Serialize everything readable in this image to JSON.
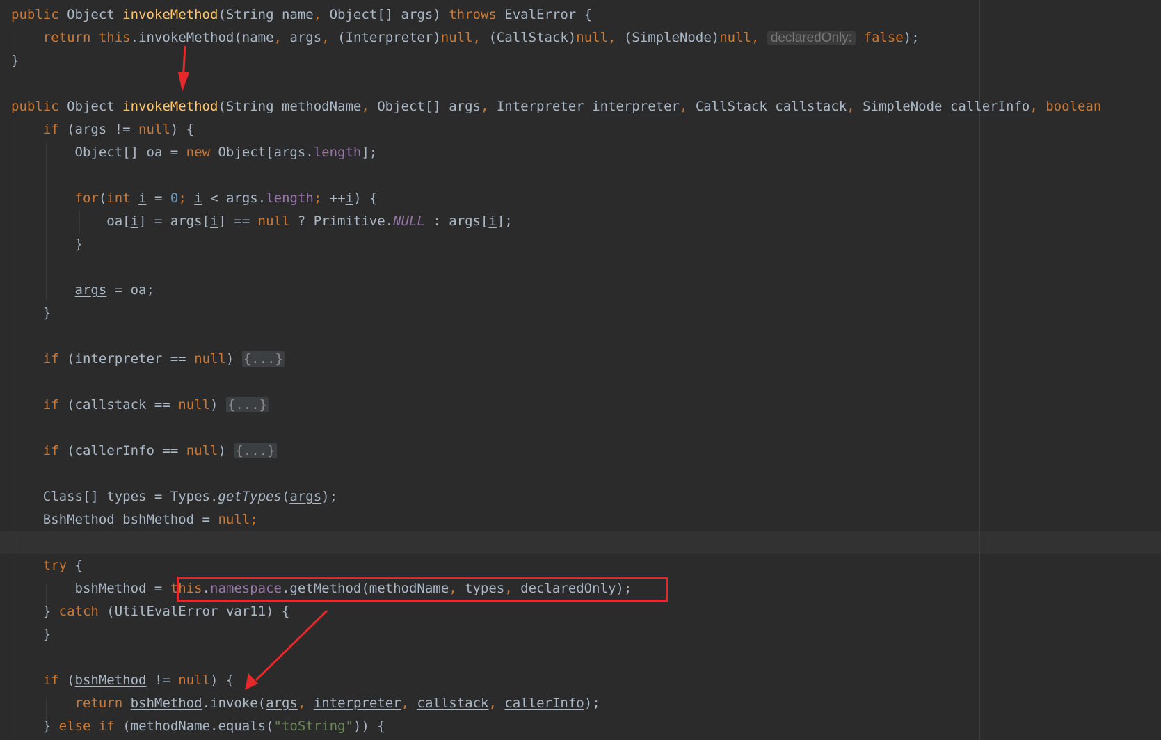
{
  "lines": [
    [
      {
        "t": "public",
        "c": "kw"
      },
      {
        "t": " Object "
      },
      {
        "t": "invokeMethod",
        "c": "fn"
      },
      {
        "t": "(String name"
      },
      {
        "t": ",",
        "c": "kw"
      },
      {
        "t": " Object[] args) "
      },
      {
        "t": "throws",
        "c": "kw"
      },
      {
        "t": " EvalError {"
      }
    ],
    [
      {
        "t": "    "
      },
      {
        "t": "return",
        "c": "kw"
      },
      {
        "t": " "
      },
      {
        "t": "this",
        "c": "kw"
      },
      {
        "t": ".invokeMethod(name"
      },
      {
        "t": ",",
        "c": "kw"
      },
      {
        "t": " args"
      },
      {
        "t": ",",
        "c": "kw"
      },
      {
        "t": " (Interpreter)"
      },
      {
        "t": "null,",
        "c": "kw"
      },
      {
        "t": " (CallStack)"
      },
      {
        "t": "null,",
        "c": "kw"
      },
      {
        "t": " (SimpleNode)"
      },
      {
        "t": "null,",
        "c": "kw"
      },
      {
        "t": " "
      },
      {
        "t": "declaredOnly:",
        "c": "hint"
      },
      {
        "t": " "
      },
      {
        "t": "false",
        "c": "kw"
      },
      {
        "t": ");"
      }
    ],
    [
      {
        "t": "}"
      }
    ],
    [],
    [
      {
        "t": "public",
        "c": "kw"
      },
      {
        "t": " Object "
      },
      {
        "t": "invokeMethod",
        "c": "fn"
      },
      {
        "t": "(String methodName"
      },
      {
        "t": ",",
        "c": "kw"
      },
      {
        "t": " Object[] "
      },
      {
        "t": "args",
        "c": "u"
      },
      {
        "t": ",",
        "c": "kw"
      },
      {
        "t": " Interpreter "
      },
      {
        "t": "interpreter",
        "c": "u"
      },
      {
        "t": ",",
        "c": "kw"
      },
      {
        "t": " CallStack "
      },
      {
        "t": "callstack",
        "c": "u"
      },
      {
        "t": ",",
        "c": "kw"
      },
      {
        "t": " SimpleNode "
      },
      {
        "t": "callerInfo",
        "c": "u"
      },
      {
        "t": ",",
        "c": "kw"
      },
      {
        "t": " boolean",
        "c": "kw"
      }
    ],
    [
      {
        "t": "    "
      },
      {
        "t": "if",
        "c": "kw"
      },
      {
        "t": " (args != "
      },
      {
        "t": "null",
        "c": "kw"
      },
      {
        "t": ") {"
      }
    ],
    [
      {
        "t": "        Object[] oa = "
      },
      {
        "t": "new",
        "c": "kw"
      },
      {
        "t": " Object[args."
      },
      {
        "t": "length",
        "c": "fld"
      },
      {
        "t": "];"
      }
    ],
    [],
    [
      {
        "t": "        "
      },
      {
        "t": "for",
        "c": "kw"
      },
      {
        "t": "("
      },
      {
        "t": "int",
        "c": "kw"
      },
      {
        "t": " "
      },
      {
        "t": "i",
        "c": "u"
      },
      {
        "t": " = "
      },
      {
        "t": "0",
        "c": "num"
      },
      {
        "t": ";",
        "c": "kw"
      },
      {
        "t": " "
      },
      {
        "t": "i",
        "c": "u"
      },
      {
        "t": " < args."
      },
      {
        "t": "length",
        "c": "fld"
      },
      {
        "t": ";",
        "c": "kw"
      },
      {
        "t": " ++"
      },
      {
        "t": "i",
        "c": "u"
      },
      {
        "t": ") {"
      }
    ],
    [
      {
        "t": "            oa["
      },
      {
        "t": "i",
        "c": "u"
      },
      {
        "t": "] = args["
      },
      {
        "t": "i",
        "c": "u"
      },
      {
        "t": "] == "
      },
      {
        "t": "null",
        "c": "kw"
      },
      {
        "t": " ? Primitive."
      },
      {
        "t": "NULL",
        "c": "sfld"
      },
      {
        "t": " : args["
      },
      {
        "t": "i",
        "c": "u"
      },
      {
        "t": "];"
      }
    ],
    [
      {
        "t": "        }"
      }
    ],
    [],
    [
      {
        "t": "        "
      },
      {
        "t": "args",
        "c": "u"
      },
      {
        "t": " = oa;"
      }
    ],
    [
      {
        "t": "    }"
      }
    ],
    [],
    [
      {
        "t": "    "
      },
      {
        "t": "if",
        "c": "kw"
      },
      {
        "t": " (interpreter == "
      },
      {
        "t": "null",
        "c": "kw"
      },
      {
        "t": ") "
      },
      {
        "t": "{...}",
        "c": "fold"
      }
    ],
    [],
    [
      {
        "t": "    "
      },
      {
        "t": "if",
        "c": "kw"
      },
      {
        "t": " (callstack == "
      },
      {
        "t": "null",
        "c": "kw"
      },
      {
        "t": ") "
      },
      {
        "t": "{...}",
        "c": "fold"
      }
    ],
    [],
    [
      {
        "t": "    "
      },
      {
        "t": "if",
        "c": "kw"
      },
      {
        "t": " (callerInfo == "
      },
      {
        "t": "null",
        "c": "kw"
      },
      {
        "t": ") "
      },
      {
        "t": "{...}",
        "c": "fold"
      }
    ],
    [],
    [
      {
        "t": "    Class[] types = Types."
      },
      {
        "t": "getTypes",
        "c": "st"
      },
      {
        "t": "("
      },
      {
        "t": "args",
        "c": "u"
      },
      {
        "t": ");"
      }
    ],
    [
      {
        "t": "    BshMethod "
      },
      {
        "t": "bshMethod",
        "c": "u"
      },
      {
        "t": " = "
      },
      {
        "t": "null;",
        "c": "kw"
      }
    ],
    [],
    [
      {
        "t": "    "
      },
      {
        "t": "try",
        "c": "kw"
      },
      {
        "t": " {"
      }
    ],
    [
      {
        "t": "        "
      },
      {
        "t": "bshMethod",
        "c": "u"
      },
      {
        "t": " = "
      },
      {
        "t": "this",
        "c": "kw"
      },
      {
        "t": "."
      },
      {
        "t": "namespace",
        "c": "fld"
      },
      {
        "t": ".getMethod(methodName"
      },
      {
        "t": ",",
        "c": "kw"
      },
      {
        "t": " types"
      },
      {
        "t": ",",
        "c": "kw"
      },
      {
        "t": " declaredOnly);"
      }
    ],
    [
      {
        "t": "    } "
      },
      {
        "t": "catch",
        "c": "kw"
      },
      {
        "t": " (UtilEvalError var11) {"
      }
    ],
    [
      {
        "t": "    }"
      }
    ],
    [],
    [
      {
        "t": "    "
      },
      {
        "t": "if",
        "c": "kw"
      },
      {
        "t": " ("
      },
      {
        "t": "bshMethod",
        "c": "u"
      },
      {
        "t": " != "
      },
      {
        "t": "null",
        "c": "kw"
      },
      {
        "t": ") {"
      }
    ],
    [
      {
        "t": "        "
      },
      {
        "t": "return",
        "c": "kw"
      },
      {
        "t": " "
      },
      {
        "t": "bshMethod",
        "c": "u"
      },
      {
        "t": ".invoke("
      },
      {
        "t": "args",
        "c": "u"
      },
      {
        "t": ",",
        "c": "kw"
      },
      {
        "t": " "
      },
      {
        "t": "interpreter",
        "c": "u"
      },
      {
        "t": ",",
        "c": "kw"
      },
      {
        "t": " "
      },
      {
        "t": "callstack",
        "c": "u"
      },
      {
        "t": ",",
        "c": "kw"
      },
      {
        "t": " "
      },
      {
        "t": "callerInfo",
        "c": "u"
      },
      {
        "t": ");"
      }
    ],
    [
      {
        "t": "    } "
      },
      {
        "t": "else",
        "c": "kw"
      },
      {
        "t": " "
      },
      {
        "t": "if",
        "c": "kw"
      },
      {
        "t": " (methodName.equals("
      },
      {
        "t": "\"toString\"",
        "c": "str"
      },
      {
        "t": ")) {"
      }
    ]
  ],
  "annotations": {
    "highlight_box_color": "#e5292b",
    "arrow_color": "#e5292b"
  }
}
